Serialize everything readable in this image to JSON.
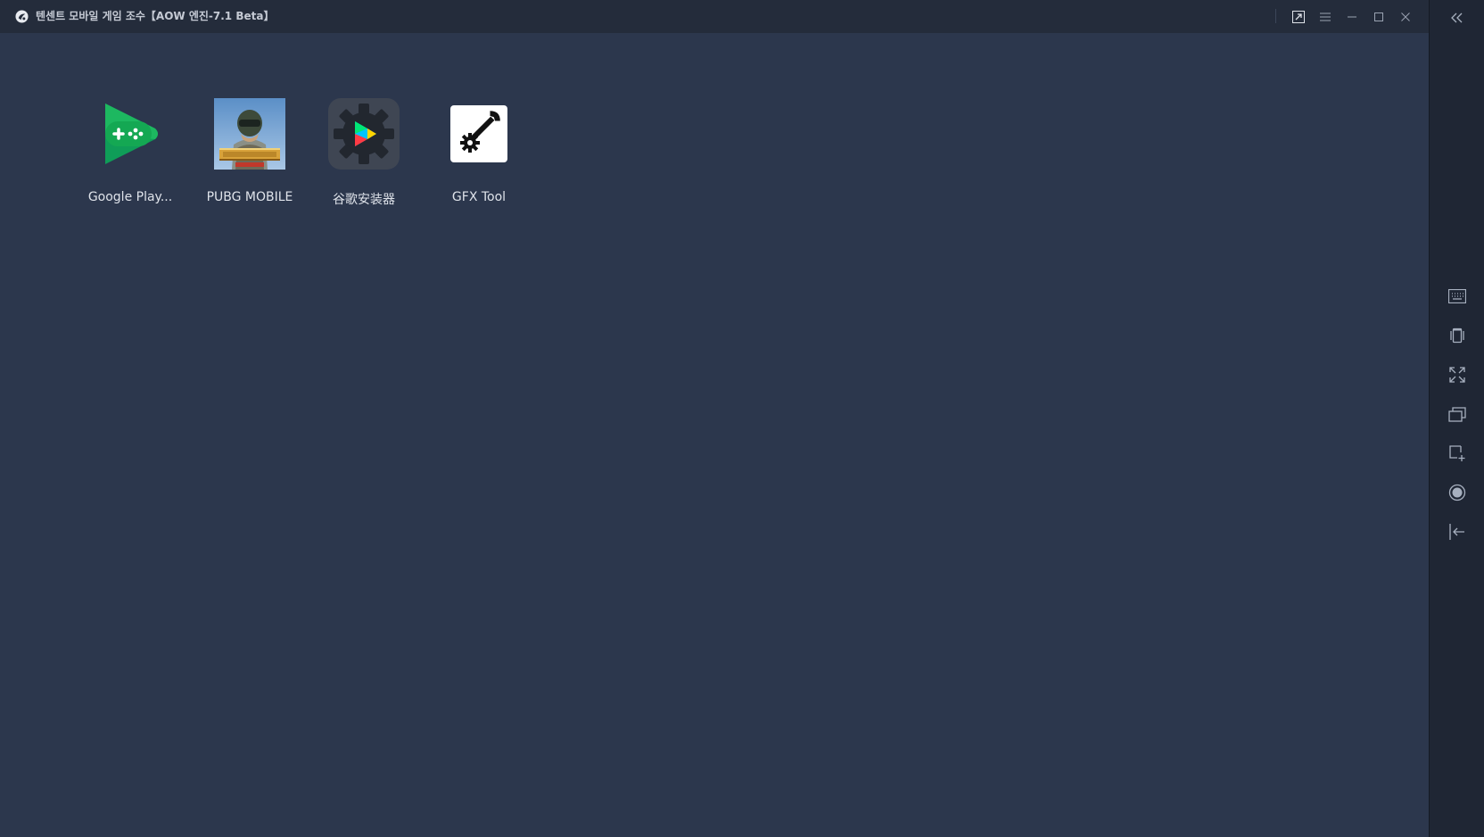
{
  "window": {
    "title": "텐센트 모바일 게임 조수【AOW 엔진-7.1 Beta】",
    "background": "#2c374d",
    "titlebar_controls": [
      "pin-icon",
      "menu-icon",
      "minimize-icon",
      "maximize-icon",
      "close-icon"
    ]
  },
  "apps": [
    {
      "label": "Google Play...",
      "icon": "google-play-games-icon"
    },
    {
      "label": "PUBG MOBILE",
      "icon": "pubg-mobile-icon"
    },
    {
      "label": "谷歌安装器",
      "icon": "google-installer-icon"
    },
    {
      "label": "GFX Tool",
      "icon": "gfx-tool-icon"
    }
  ],
  "sidebar": {
    "items": [
      "collapse-sidebar-icon",
      "keyboard-icon",
      "shake-icon",
      "fullscreen-icon",
      "multi-window-icon",
      "screenshot-icon",
      "record-icon",
      "exit-icon"
    ]
  }
}
